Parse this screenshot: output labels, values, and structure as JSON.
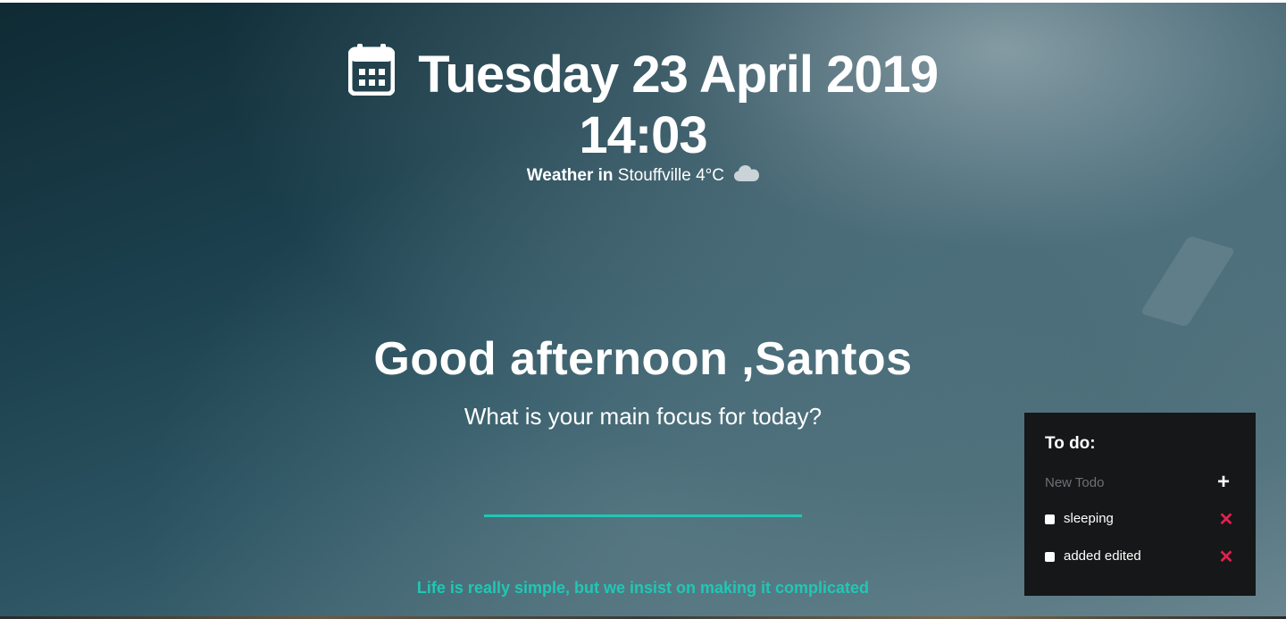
{
  "header": {
    "date": "Tuesday 23 April 2019",
    "time": "14:03",
    "weather_label": "Weather in",
    "weather_value": "Stouffville 4°C",
    "calendar_icon": "calendar-icon",
    "weather_icon": "cloud-icon"
  },
  "main": {
    "greeting": "Good afternoon ,Santos",
    "focus_question": "What is your main focus for today?",
    "focus_input_value": "",
    "quote": "Life is really simple, but we insist on making it complicated"
  },
  "todo": {
    "title": "To do:",
    "new_placeholder": "New Todo",
    "add_label": "+",
    "delete_label": "✕",
    "items": [
      {
        "label": "sleeping",
        "checked": false
      },
      {
        "label": "added edited",
        "checked": false
      }
    ]
  },
  "colors": {
    "accent": "#1fc8b4",
    "delete": "#e91e4f",
    "panel_bg": "#161718"
  }
}
